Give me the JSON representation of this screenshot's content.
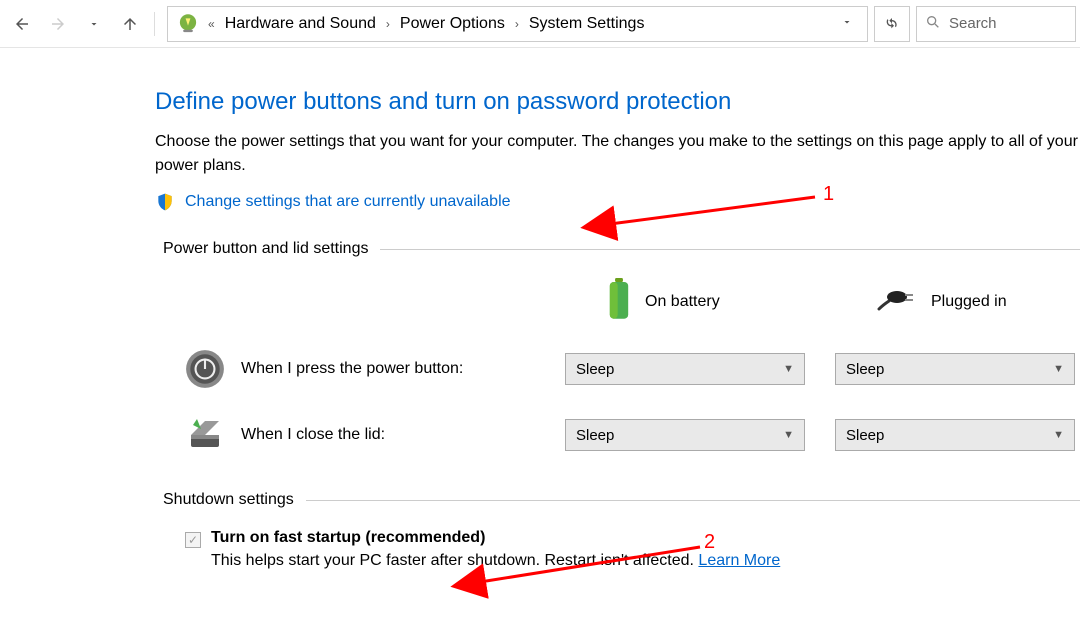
{
  "breadcrumb": {
    "items": [
      "Hardware and Sound",
      "Power Options",
      "System Settings"
    ]
  },
  "search": {
    "placeholder": "Search"
  },
  "page": {
    "title": "Define power buttons and turn on password protection",
    "description": "Choose the power settings that you want for your computer. The changes you make to the settings on this page apply to all of your power plans.",
    "change_link": "Change settings that are currently unavailable"
  },
  "power_section": {
    "heading": "Power button and lid settings",
    "col_battery": "On battery",
    "col_plugged": "Plugged in",
    "rows": [
      {
        "label": "When I press the power button:",
        "battery": "Sleep",
        "plugged": "Sleep"
      },
      {
        "label": "When I close the lid:",
        "battery": "Sleep",
        "plugged": "Sleep"
      }
    ]
  },
  "shutdown_section": {
    "heading": "Shutdown settings",
    "fast_startup_label": "Turn on fast startup (recommended)",
    "fast_startup_checked": true,
    "fast_startup_help": "This helps start your PC faster after shutdown. Restart isn't affected. ",
    "learn_more": "Learn More"
  },
  "annotations": {
    "a1": "1",
    "a2": "2"
  }
}
